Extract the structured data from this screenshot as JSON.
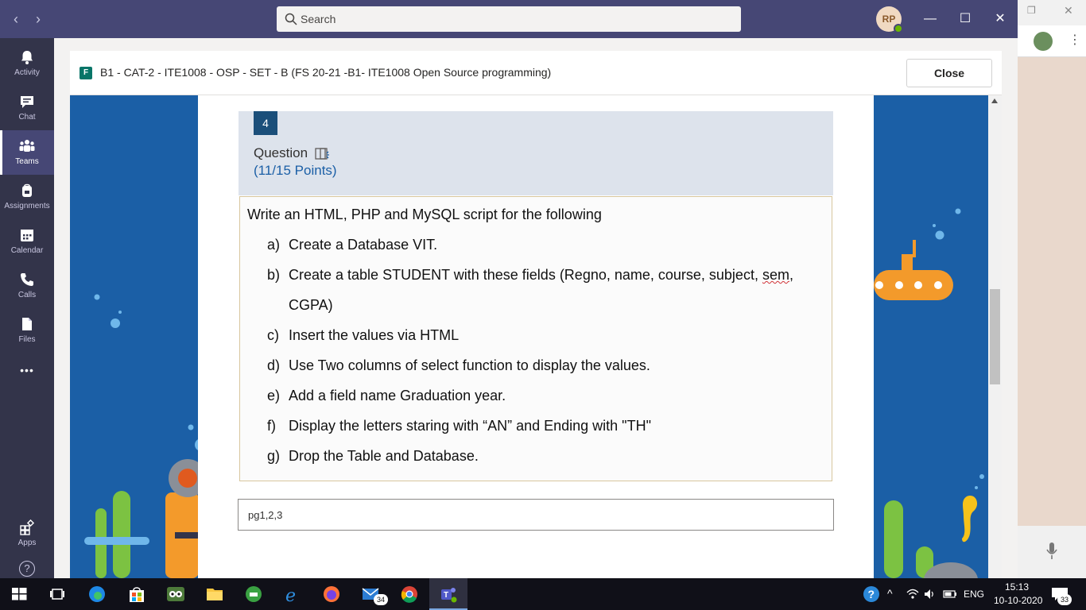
{
  "titlebar": {
    "search_placeholder": "Search",
    "avatar_initials": "RP",
    "nav_back": "‹",
    "nav_forward": "›",
    "minimize": "—",
    "maximize": "☐",
    "close": "✕"
  },
  "rail": {
    "items": [
      {
        "label": "Activity",
        "icon": "bell-icon"
      },
      {
        "label": "Chat",
        "icon": "chat-icon"
      },
      {
        "label": "Teams",
        "icon": "teams-icon"
      },
      {
        "label": "Assignments",
        "icon": "backpack-icon"
      },
      {
        "label": "Calendar",
        "icon": "calendar-icon"
      },
      {
        "label": "Calls",
        "icon": "phone-icon"
      },
      {
        "label": "Files",
        "icon": "file-icon"
      }
    ],
    "more": "•••",
    "apps_label": "Apps",
    "help": "?"
  },
  "form": {
    "title": "B1 - CAT-2 - ITE1008 - OSP - SET - B (FS 20-21 -B1- ITE1008 Open Source programming)",
    "close_label": "Close",
    "forms_icon_letter": "F"
  },
  "question": {
    "number": "4",
    "label": "Question",
    "points": "(11/15 Points)",
    "intro": "Write an HTML, PHP and  MySQL script for the following",
    "items": [
      {
        "key": "a)",
        "text": "Create a Database VIT."
      },
      {
        "key": "b)",
        "text": "Create a table STUDENT with these fields (Regno, name, course, subject, ",
        "squiggle": "sem",
        "tail": ","
      },
      {
        "key": "",
        "text": "CGPA)"
      },
      {
        "key": "c)",
        "text": "Insert the values via HTML"
      },
      {
        "key": "d)",
        "text": "Use Two columns of select function to display the values."
      },
      {
        "key": "e)",
        "text": "Add a field name Graduation year."
      },
      {
        "key": "f)",
        "text": "Display the letters staring with “AN” and Ending with \"TH\""
      },
      {
        "key": "g)",
        "text": "Drop the Table and Database."
      }
    ],
    "answer": "pg1,2,3"
  },
  "taskbar": {
    "mail_badge": "34",
    "language": "ENG",
    "time": "15:13",
    "date": "10-10-2020",
    "notif_count": "33"
  },
  "colors": {
    "teams_purple": "#464775",
    "rail_bg": "#33344a",
    "canvas_blue": "#1b5fa6",
    "question_badge": "#1b4f7a"
  }
}
